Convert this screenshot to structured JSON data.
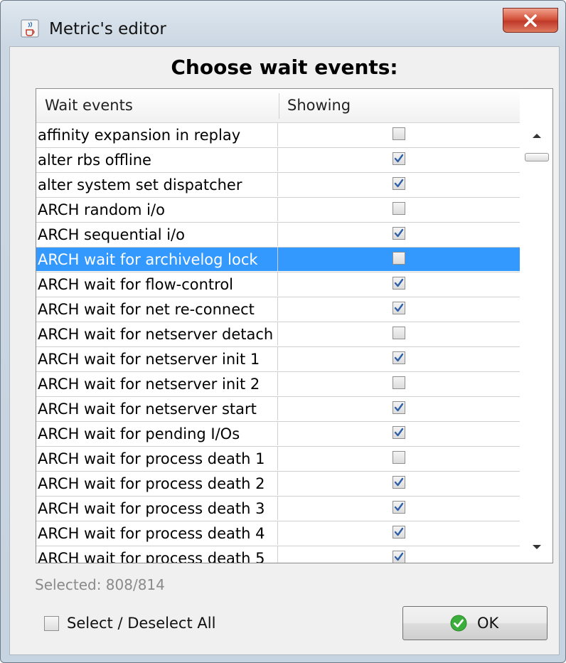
{
  "window": {
    "title": "Metric's editor",
    "close_icon": "close-x-icon",
    "app_icon": "java-cup-icon"
  },
  "dialog": {
    "heading": "Choose wait events:",
    "columns": [
      "Wait events",
      "Showing"
    ],
    "rows": [
      {
        "name": "affinity expansion in replay",
        "showing": false,
        "selected": false
      },
      {
        "name": "alter rbs offline",
        "showing": true,
        "selected": false
      },
      {
        "name": "alter system set dispatcher",
        "showing": true,
        "selected": false
      },
      {
        "name": "ARCH random i/o",
        "showing": false,
        "selected": false
      },
      {
        "name": "ARCH sequential i/o",
        "showing": true,
        "selected": false
      },
      {
        "name": "ARCH wait for archivelog lock",
        "showing": false,
        "selected": true
      },
      {
        "name": "ARCH wait for flow-control",
        "showing": true,
        "selected": false
      },
      {
        "name": "ARCH wait for net re-connect",
        "showing": true,
        "selected": false
      },
      {
        "name": "ARCH wait for netserver detach",
        "showing": false,
        "selected": false
      },
      {
        "name": "ARCH wait for netserver init 1",
        "showing": true,
        "selected": false
      },
      {
        "name": "ARCH wait for netserver init 2",
        "showing": false,
        "selected": false
      },
      {
        "name": "ARCH wait for netserver start",
        "showing": true,
        "selected": false
      },
      {
        "name": "ARCH wait for pending I/Os",
        "showing": true,
        "selected": false
      },
      {
        "name": "ARCH wait for process death 1",
        "showing": false,
        "selected": false
      },
      {
        "name": "ARCH wait for process death 2",
        "showing": true,
        "selected": false
      },
      {
        "name": "ARCH wait for process death 3",
        "showing": true,
        "selected": false
      },
      {
        "name": "ARCH wait for process death 4",
        "showing": true,
        "selected": false
      },
      {
        "name": "ARCH wait for process death 5",
        "showing": true,
        "selected": false
      }
    ],
    "selected_count_text": "Selected: 808/814",
    "select_all_label": "Select / Deselect All",
    "select_all_checked": false,
    "ok_label": "OK"
  },
  "colors": {
    "selection": "#3399ff",
    "close_button": "#c0392b",
    "ok_icon": "#3cae3c"
  }
}
